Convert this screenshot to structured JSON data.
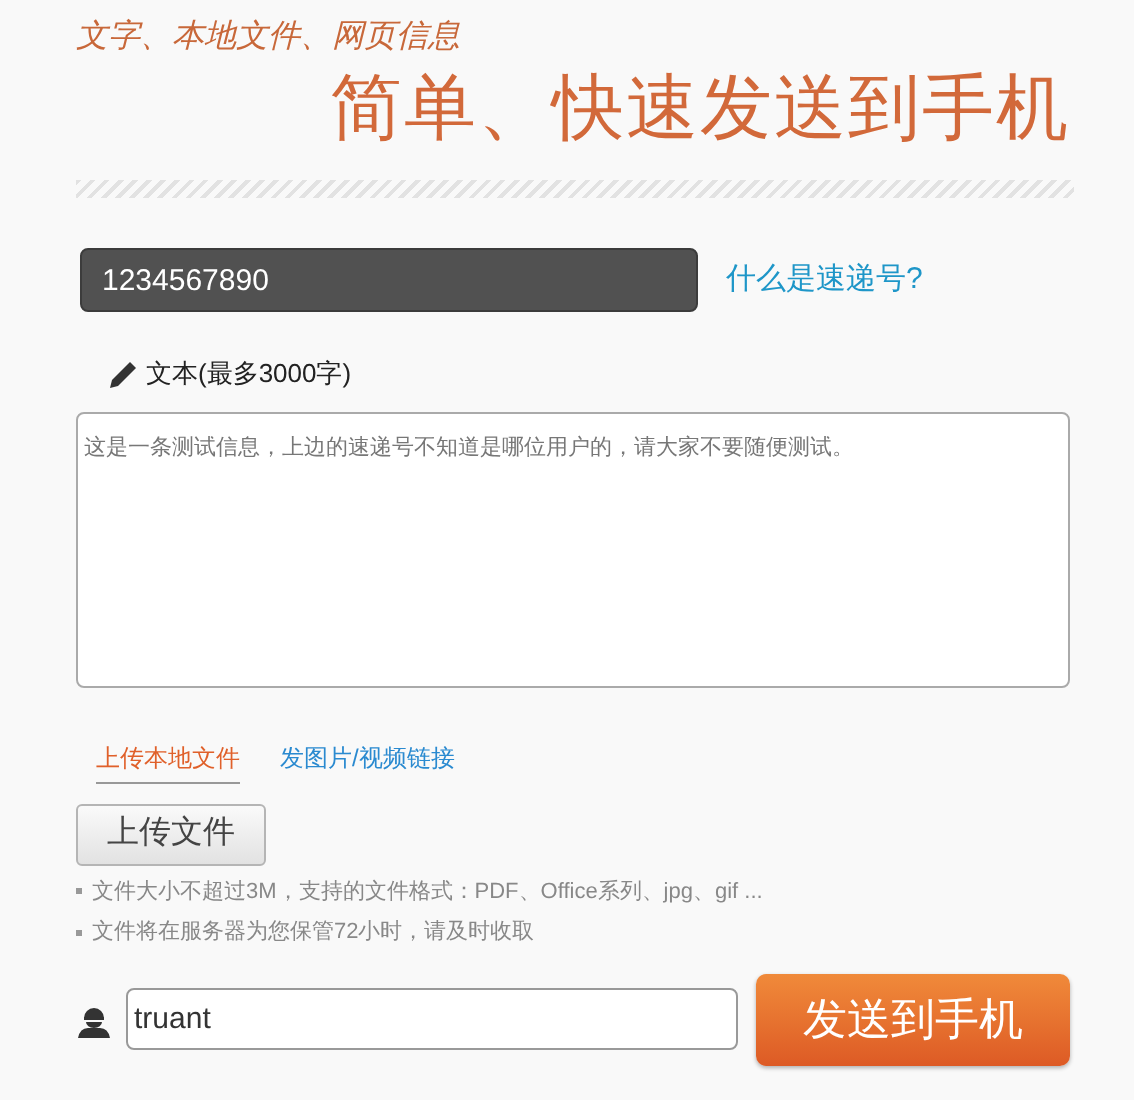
{
  "header": {
    "subtitle": "文字、本地文件、网页信息",
    "title": "简单、快速发送到手机"
  },
  "code_field": {
    "value": "1234567890"
  },
  "help_link": "什么是速递号?",
  "text_label": "文本(最多3000字)",
  "text_area": {
    "value": "这是一条测试信息，上边的速递号不知道是哪位用户的，请大家不要随便测试。"
  },
  "tabs": [
    {
      "label": "上传本地文件",
      "selected": true
    },
    {
      "label": "发图片/视频链接",
      "selected": false
    }
  ],
  "upload_button": "上传文件",
  "notes": [
    "文件大小不超过3M，支持的文件格式：PDF、Office系列、jpg、gif ...",
    "文件将在服务器为您保管72小时，请及时收取"
  ],
  "name_field": {
    "value": "truant"
  },
  "send_button": "发送到手机"
}
